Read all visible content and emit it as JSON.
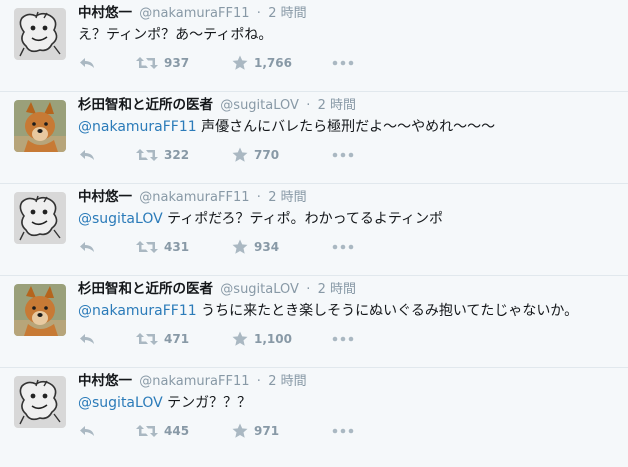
{
  "tweets": [
    {
      "name": "中村悠一",
      "screen_name": "@nakamuraFF11",
      "separator": "·",
      "time": "2 時間",
      "mention": "",
      "text": "え？ティンポ？あ～ティポね。",
      "retweets": "937",
      "favorites": "1,766",
      "avatar": "sketch"
    },
    {
      "name": "杉田智和と近所の医者",
      "screen_name": "@sugitaLOV",
      "separator": "·",
      "time": "2 時間",
      "mention": "@nakamuraFF11",
      "text": " 声優さんにバレたら極刑だよ～～やめれ～～～",
      "retweets": "322",
      "favorites": "770",
      "avatar": "dog"
    },
    {
      "name": "中村悠一",
      "screen_name": "@nakamuraFF11",
      "separator": "·",
      "time": "2 時間",
      "mention": "@sugitaLOV",
      "text": " ティポだろ？ティポ。わかってるよティンポ",
      "retweets": "431",
      "favorites": "934",
      "avatar": "sketch"
    },
    {
      "name": "杉田智和と近所の医者",
      "screen_name": "@sugitaLOV",
      "separator": "·",
      "time": "2 時間",
      "mention": "@nakamuraFF11",
      "text": " うちに来たとき楽しそうにぬいぐるみ抱いてたじゃないか。",
      "retweets": "471",
      "favorites": "1,100",
      "avatar": "dog"
    },
    {
      "name": "中村悠一",
      "screen_name": "@nakamuraFF11",
      "separator": "·",
      "time": "2 時間",
      "mention": "@sugitaLOV",
      "text": " テンガ？？？",
      "retweets": "445",
      "favorites": "971",
      "avatar": "sketch"
    }
  ],
  "icons": {
    "reply": "reply-icon",
    "retweet": "retweet-icon",
    "favorite": "star-icon",
    "more": "more-dots-icon"
  },
  "colors": {
    "background": "#f5f8fa",
    "text": "#14171a",
    "secondary": "#8899a6",
    "link": "#2b7bb9",
    "icon": "#aab8c2",
    "divider": "#e1e8ed"
  }
}
